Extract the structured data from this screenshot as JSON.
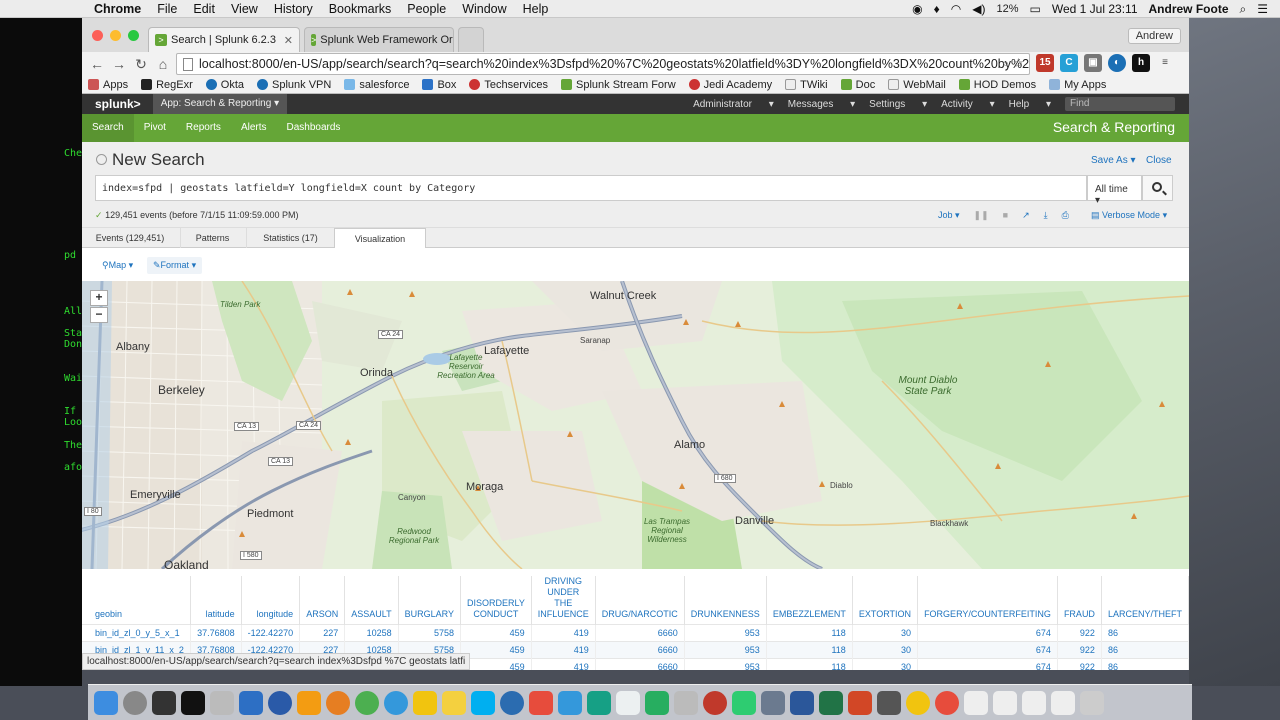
{
  "menubar": {
    "app": "Chrome",
    "items": [
      "File",
      "Edit",
      "View",
      "History",
      "Bookmarks",
      "People",
      "Window",
      "Help"
    ],
    "battery": "12%",
    "datetime": "Wed 1 Jul  23:11",
    "user": "Andrew Foote"
  },
  "browser": {
    "profile": "Andrew",
    "tabs": [
      {
        "label": "Search | Splunk 6.2.3"
      },
      {
        "label": "Splunk Web Framework Or"
      }
    ],
    "url": "localhost:8000/en-US/app/search/search?q=search%20index%3Dsfpd%20%7C%20geostats%20latfield%3DY%20longfield%3DX%20count%20by%2...",
    "bookmarks": [
      "Apps",
      "RegExr",
      "Okta",
      "Splunk VPN",
      "salesforce",
      "Box",
      "Techservices",
      "Splunk Stream Forw",
      "Jedi Academy",
      "TWiki",
      "Doc",
      "WebMail",
      "HOD Demos",
      "My Apps"
    ]
  },
  "terminal": {
    "lines": [
      "Che",
      "pd",
      "All",
      "Sta",
      "Don",
      "Wai",
      "If",
      "Loo",
      "The",
      "afo"
    ]
  },
  "splunk": {
    "logo": "splunk>",
    "app_menu": "App: Search & Reporting",
    "top_right": [
      "Administrator",
      "Messages",
      "Settings",
      "Activity",
      "Help"
    ],
    "find_placeholder": "Find",
    "nav": [
      "Search",
      "Pivot",
      "Reports",
      "Alerts",
      "Dashboards"
    ],
    "brand": "Search & Reporting",
    "page_title": "New Search",
    "save_as": "Save As",
    "close": "Close",
    "query": "index=sfpd | geostats latfield=Y longfield=X count by Category",
    "time_range": "All time",
    "events_info": "129,451 events (before 7/1/15 11:09:59.000 PM)",
    "job": "Job",
    "verbose": "Verbose Mode",
    "tabs": [
      "Events (129,451)",
      "Patterns",
      "Statistics (17)",
      "Visualization"
    ],
    "viz_buttons": [
      "Map",
      "Format"
    ]
  },
  "map": {
    "labels": [
      "Walnut Creek",
      "Tilden Park",
      "Albany",
      "Lafayette",
      "Saranap",
      "Lafayette Reservoir Recreation Area",
      "Orinda",
      "Berkeley",
      "Mount Diablo State Park",
      "Alamo",
      "Moraga",
      "Emeryville",
      "Piedmont",
      "Canyon",
      "Redwood Regional Park",
      "Las Trampas Regional Wilderness",
      "Danville",
      "Diablo",
      "Blackhawk",
      "Oakland"
    ],
    "shields": [
      "CA 24",
      "CA 13",
      "I 580",
      "I 680",
      "I 80"
    ]
  },
  "table": {
    "columns": [
      "geobin",
      "latitude",
      "longitude",
      "ARSON",
      "ASSAULT",
      "BURGLARY",
      "DISORDERLY CONDUCT",
      "DRIVING UNDER THE INFLUENCE",
      "DRUG/NARCOTIC",
      "DRUNKENNESS",
      "EMBEZZLEMENT",
      "EXTORTION",
      "FORGERY/COUNTERFEITING",
      "FRAUD",
      "LARCENY/THEFT"
    ],
    "rows": [
      [
        "bin_id_zl_0_y_5_x_1",
        "37.76808",
        "-122.42270",
        "227",
        "10258",
        "5758",
        "459",
        "419",
        "6660",
        "953",
        "118",
        "30",
        "674",
        "922",
        "86"
      ],
      [
        "bin_id_zl_1_y_11_x_2",
        "37.76808",
        "-122.42270",
        "227",
        "10258",
        "5758",
        "459",
        "419",
        "6660",
        "953",
        "118",
        "30",
        "674",
        "922",
        "86"
      ],
      [
        "",
        "",
        "",
        "",
        "",
        "5758",
        "459",
        "419",
        "6660",
        "953",
        "118",
        "30",
        "674",
        "922",
        "86"
      ]
    ]
  },
  "status_url": "localhost:8000/en-US/app/search/search?q=search index%3Dsfpd %7C geostats latfi"
}
